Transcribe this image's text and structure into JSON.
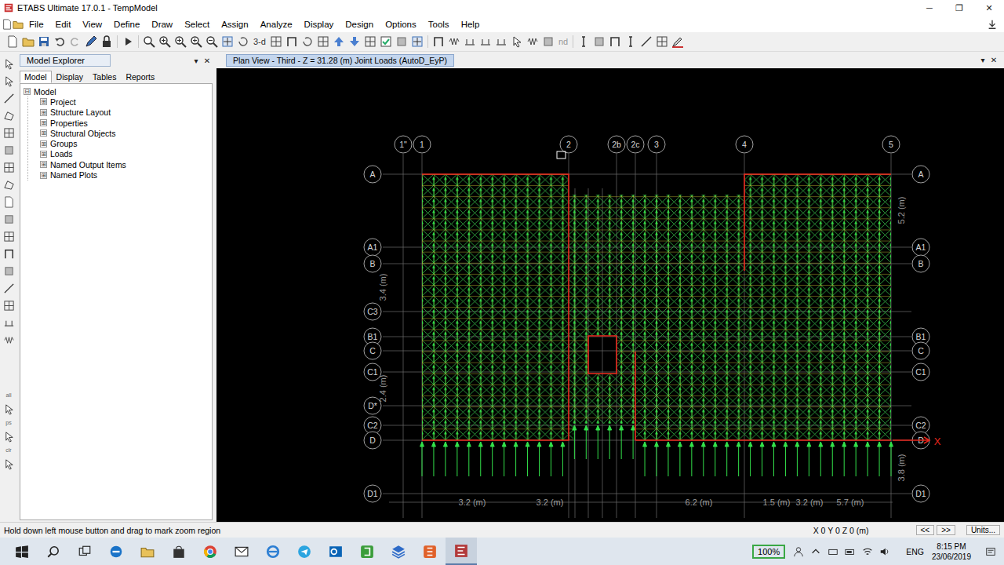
{
  "window": {
    "title": "ETABS Ultimate 17.0.1 - TempModel",
    "controls": [
      "─",
      "❐",
      "✕"
    ]
  },
  "menu": [
    "File",
    "Edit",
    "View",
    "Define",
    "Draw",
    "Select",
    "Assign",
    "Analyze",
    "Display",
    "Design",
    "Options",
    "Tools",
    "Help"
  ],
  "toolbar_texts": [
    "3-d",
    "nd"
  ],
  "side_tool_texts": [
    "all",
    "ps",
    "clr"
  ],
  "explorer": {
    "title": "Model Explorer",
    "pin": "▾",
    "close": "✕",
    "tabs": [
      {
        "label": "Model",
        "selected": true
      },
      {
        "label": "Display",
        "selected": false
      },
      {
        "label": "Tables",
        "selected": false
      },
      {
        "label": "Reports",
        "selected": false
      }
    ],
    "root": {
      "label": "Model",
      "toggle": "⊟",
      "expanded": true
    },
    "items": [
      {
        "label": "Project",
        "toggle": "⊞",
        "expanded": false
      },
      {
        "label": "Structure Layout",
        "toggle": "⊞",
        "expanded": false
      },
      {
        "label": "Properties",
        "toggle": "⊞",
        "expanded": false
      },
      {
        "label": "Structural Objects",
        "toggle": "⊞",
        "expanded": false
      },
      {
        "label": "Groups",
        "toggle": "⊞",
        "expanded": false
      },
      {
        "label": "Loads",
        "toggle": "⊞",
        "expanded": false
      },
      {
        "label": "Named Output Items",
        "toggle": "⊞",
        "expanded": false
      },
      {
        "label": "Named Plots",
        "toggle": "⊞",
        "expanded": false
      }
    ]
  },
  "view": {
    "tab": {
      "label": "Plan View - Third - Z = 31.28 (m)  Joint Loads (AutoD_EyP)",
      "selected": true
    },
    "menu": "▾",
    "close": "✕",
    "grid": {
      "top": [
        "1\"",
        "1",
        "2",
        "2b",
        "2c",
        "3",
        "4",
        "5"
      ],
      "left": [
        "A",
        "A1",
        "B",
        "C3",
        "B1",
        "C",
        "C1",
        "D*",
        "C2",
        "D",
        "D1"
      ],
      "right": [
        "A",
        "A1",
        "B",
        "B1",
        "C",
        "C1",
        "C2",
        "D",
        "D1"
      ]
    },
    "dims": {
      "bottom": [
        "3.2 (m)",
        "3.2 (m)",
        "6.2 (m)",
        "1.5 (m)",
        "3.2 (m)",
        "5.7 (m)"
      ],
      "left": [
        "3.4 (m)",
        "2.4 (m)"
      ],
      "right": [
        "5.2 (m)",
        "3.8 (m)"
      ]
    },
    "axis": "X"
  },
  "status": {
    "message": "Hold down left mouse button and drag to mark zoom region",
    "coords": "X 0 Y 0 Z 0 (m)",
    "prev": "<<",
    "next": ">>",
    "units": "Units..."
  },
  "taskbar": {
    "zoom": "100%",
    "lang": "ENG",
    "time": "8:15 PM",
    "date": "23/06/2019"
  }
}
